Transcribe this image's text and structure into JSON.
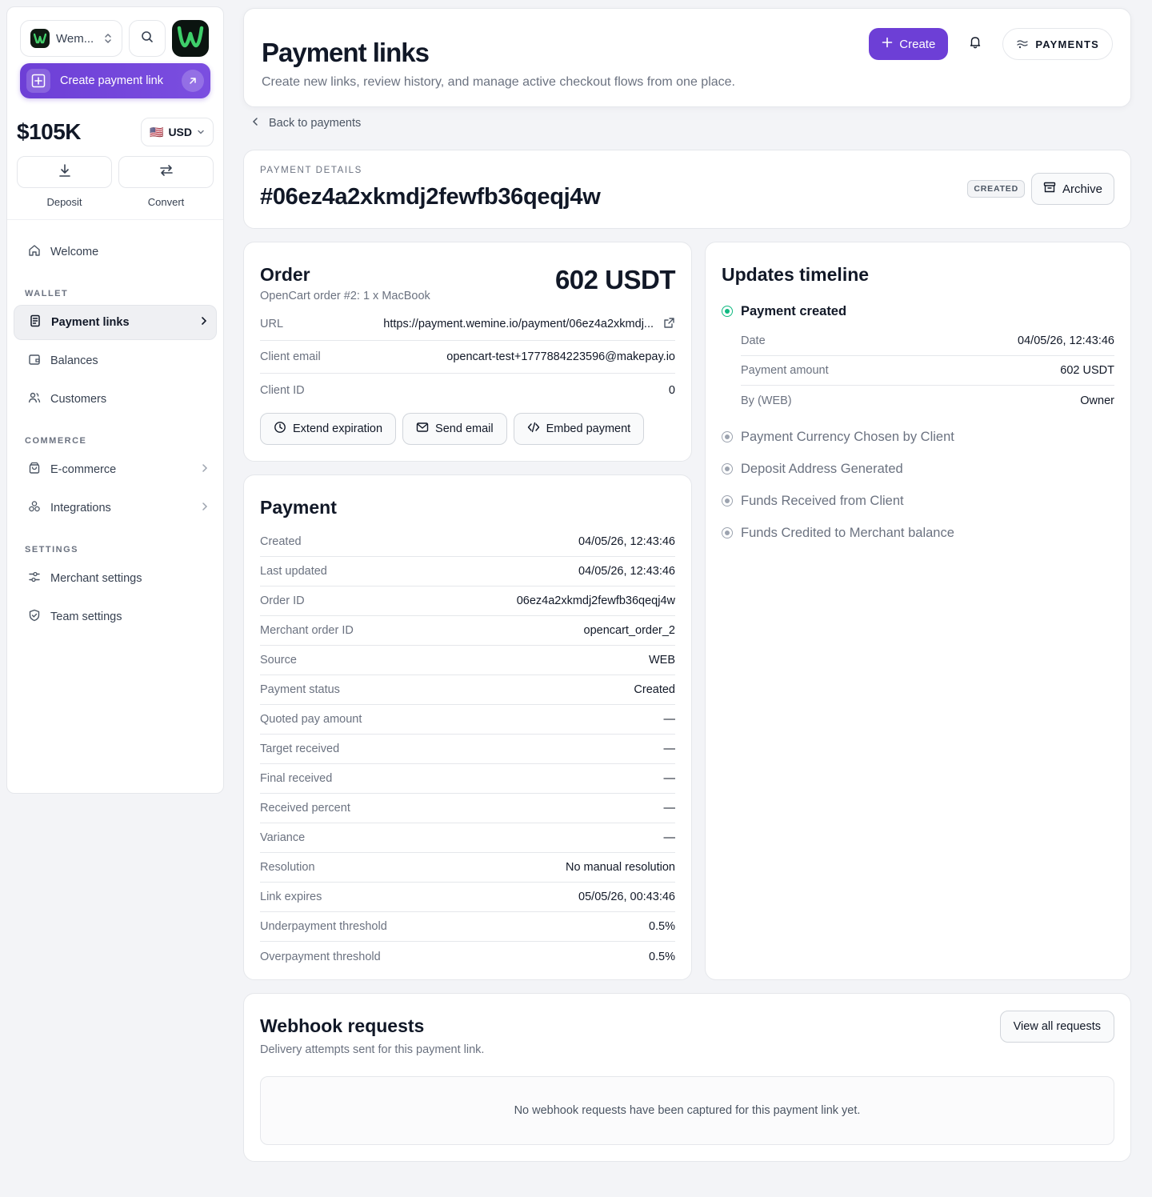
{
  "sidebar": {
    "workspace_name": "Wem...",
    "create_link_label": "Create payment link",
    "balance": "$105K",
    "currency": "USD",
    "currency_flag": "🇺🇸",
    "deposit_label": "Deposit",
    "convert_label": "Convert",
    "nav": {
      "welcome": "Welcome",
      "wallet_section": "WALLET",
      "payment_links": "Payment links",
      "balances": "Balances",
      "customers": "Customers",
      "commerce_section": "COMMERCE",
      "ecommerce": "E-commerce",
      "integrations": "Integrations",
      "settings_section": "SETTINGS",
      "merchant_settings": "Merchant settings",
      "team_settings": "Team settings"
    }
  },
  "header": {
    "title": "Payment links",
    "subtitle": "Create new links, review history, and manage active checkout flows from one place.",
    "create_label": "Create",
    "payments_label": "PAYMENTS"
  },
  "back_label": "Back to payments",
  "details": {
    "eyebrow": "PAYMENT DETAILS",
    "payment_id": "#06ez4a2xkmdj2fewfb36qeqj4w",
    "status_badge": "CREATED",
    "archive_label": "Archive"
  },
  "order": {
    "title": "Order",
    "subtitle": "OpenCart order #2: 1 x MacBook",
    "amount": "602 USDT",
    "rows": [
      {
        "k": "URL",
        "v": "https://payment.wemine.io/payment/06ez4a2xkmdj..."
      },
      {
        "k": "Client email",
        "v": "opencart-test+1777884223596@makepay.io"
      },
      {
        "k": "Client ID",
        "v": "0"
      }
    ],
    "extend_label": "Extend expiration",
    "send_email_label": "Send email",
    "embed_label": "Embed payment"
  },
  "payment": {
    "title": "Payment",
    "rows": [
      {
        "k": "Created",
        "v": "04/05/26, 12:43:46"
      },
      {
        "k": "Last updated",
        "v": "04/05/26, 12:43:46"
      },
      {
        "k": "Order ID",
        "v": "06ez4a2xkmdj2fewfb36qeqj4w"
      },
      {
        "k": "Merchant order ID",
        "v": "opencart_order_2"
      },
      {
        "k": "Source",
        "v": "WEB"
      },
      {
        "k": "Payment status",
        "v": "Created"
      },
      {
        "k": "Quoted pay amount",
        "v": "—"
      },
      {
        "k": "Target received",
        "v": "—"
      },
      {
        "k": "Final received",
        "v": "—"
      },
      {
        "k": "Received percent",
        "v": "—"
      },
      {
        "k": "Variance",
        "v": "—"
      },
      {
        "k": "Resolution",
        "v": "No manual resolution"
      },
      {
        "k": "Link expires",
        "v": "05/05/26, 00:43:46"
      },
      {
        "k": "Underpayment threshold",
        "v": "0.5%"
      },
      {
        "k": "Overpayment threshold",
        "v": "0.5%"
      }
    ]
  },
  "timeline": {
    "title": "Updates timeline",
    "first": {
      "label": "Payment created",
      "rows": [
        {
          "k": "Date",
          "v": "04/05/26, 12:43:46"
        },
        {
          "k": "Payment amount",
          "v": "602 USDT"
        },
        {
          "k": "By (WEB)",
          "v": "Owner"
        }
      ]
    },
    "pending": [
      "Payment Currency Chosen by Client",
      "Deposit Address Generated",
      "Funds Received from Client",
      "Funds Credited to Merchant balance"
    ]
  },
  "webhooks": {
    "title": "Webhook requests",
    "subtitle": "Delivery attempts sent for this payment link.",
    "view_all_label": "View all requests",
    "empty_text": "No webhook requests have been captured for this payment link yet."
  },
  "colors": {
    "accent": "#6d3fd6",
    "success": "#10b981",
    "background": "#f3f4f7"
  }
}
